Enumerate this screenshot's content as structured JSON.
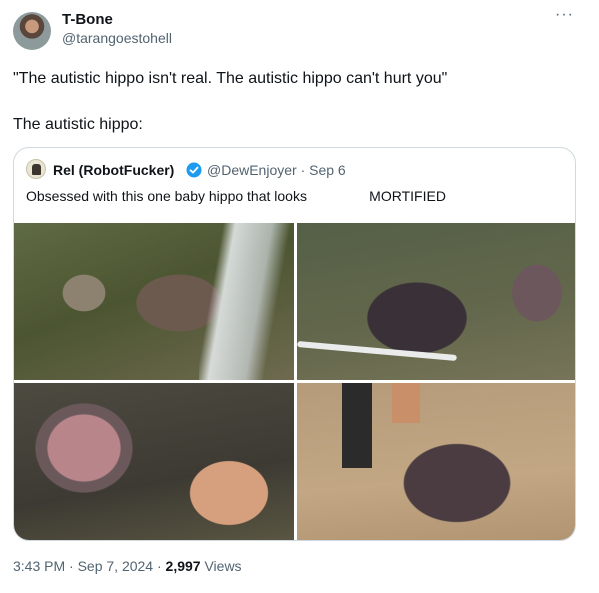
{
  "tweet": {
    "author_name": "T-Bone",
    "author_handle": "@tarangoestohell",
    "more_label": "···",
    "text_line1": "\"The autistic hippo isn't real. The autistic hippo can't hurt you\"",
    "text_line2": "The autistic hippo:",
    "time": "3:43 PM · Sep 7, 2024 · ",
    "views_count": "2,997",
    "views_label": " Views"
  },
  "quoted": {
    "author_name": "Rel (RobotFucker)",
    "verified_icon": "verified-badge-icon",
    "handle_date": "@DewEnjoyer · Sep 6",
    "text": "Obsessed with this one baby hippo that looks                MORTIFIED",
    "photos": [
      {
        "name": "hippo-photo-1"
      },
      {
        "name": "hippo-photo-2"
      },
      {
        "name": "hippo-photo-3"
      },
      {
        "name": "hippo-photo-4"
      }
    ]
  },
  "colors": {
    "text": "#0f1419",
    "secondary": "#536471",
    "border": "#cfd9de",
    "verified": "#1d9bf0"
  }
}
